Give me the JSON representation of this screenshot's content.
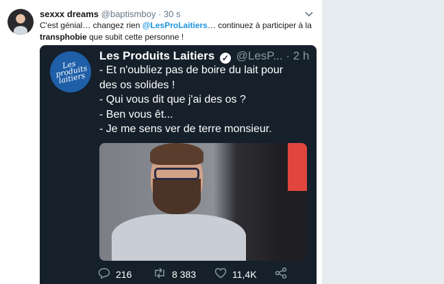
{
  "tweet": {
    "display_name": "sexxx dreams",
    "handle": "@baptismboy",
    "separator": "·",
    "time": "30 s",
    "text_part1": "C'est génial… changez rien ",
    "mention": "@LesProLaitiers",
    "text_part2": "… continuez à participer à la",
    "bold_word": "transphobie",
    "text_part3": " que subit cette personne !",
    "menu_icon": "chevron-down-icon"
  },
  "embed": {
    "avatar_text": "Les produits laitiers",
    "name": "Les Produits Laitiers",
    "handle": "@LesP...",
    "separator": "·",
    "time": "2 h",
    "lines": [
      "- Et n'oubliez pas de boire du lait pour",
      "des os solides !",
      "- Qui vous dit que j'ai des os ?",
      "- Ben vous êt...",
      "- Je me sens ver de terre monsieur."
    ],
    "actions": {
      "reply_count": "216",
      "retweet_count": "8 383",
      "like_count": "11,4K"
    }
  },
  "colors": {
    "accent": "#1b95e0",
    "embed_background": "#15202b",
    "brand_avatar": "#1f5fa8"
  }
}
